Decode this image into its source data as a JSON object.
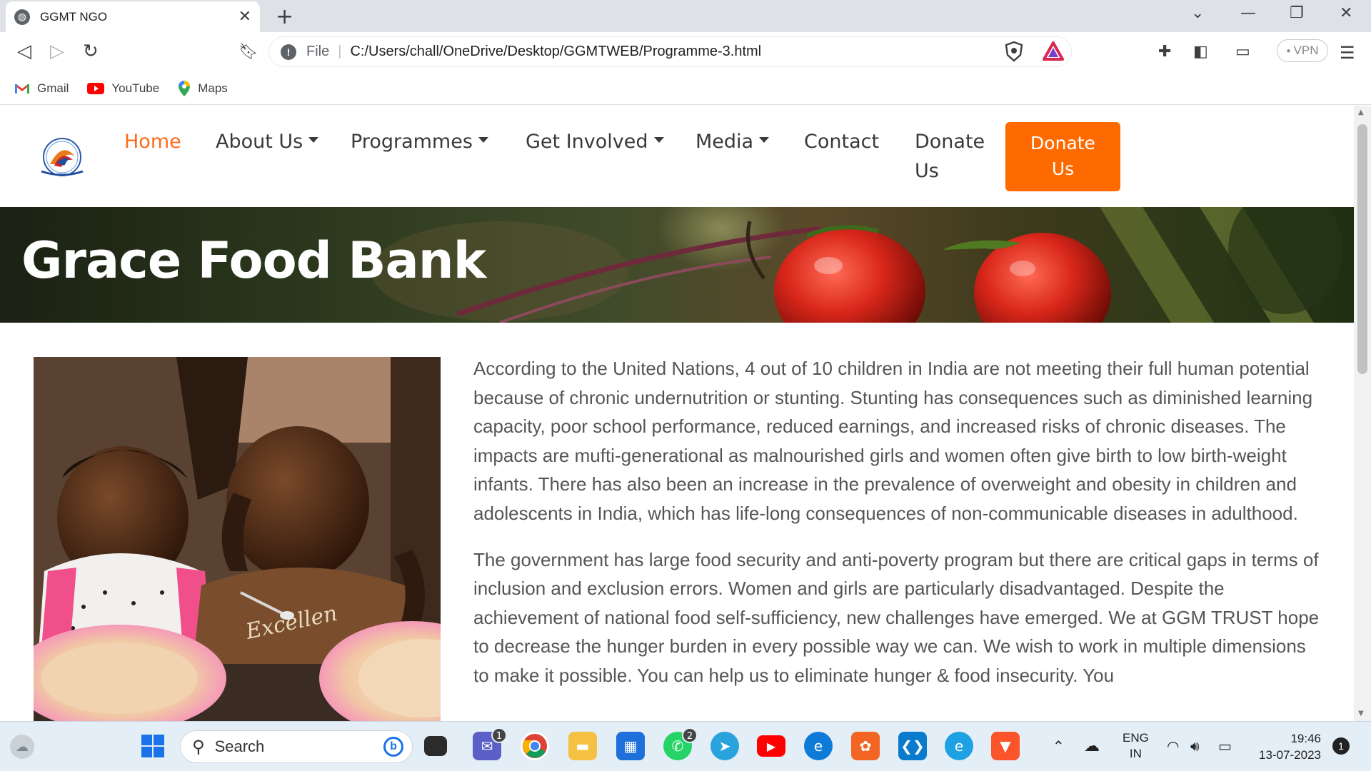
{
  "browser": {
    "tab_title": "GGMT NGO",
    "url_scheme": "File",
    "url_path": "C:/Users/chall/OneDrive/Desktop/GGMTWEB/Programme-3.html",
    "vpn_label": "VPN",
    "bookmarks": [
      {
        "label": "Gmail",
        "icon": "gmail-icon"
      },
      {
        "label": "YouTube",
        "icon": "youtube-icon"
      },
      {
        "label": "Maps",
        "icon": "maps-icon"
      }
    ]
  },
  "site": {
    "nav": {
      "home": "Home",
      "about": "About Us",
      "programmes": "Programmes",
      "get_involved": "Get Involved",
      "media": "Media",
      "contact": "Contact",
      "donate_line1": "Donate",
      "donate_line2": "Us",
      "donate_button_line1": "Donate",
      "donate_button_line2": "Us"
    },
    "accent_color": "#ff6a00",
    "hero_title": "Grace Food Bank",
    "paragraphs": [
      "According to the United Nations, 4 out of 10 children in India are not meeting their full human potential because of chronic undernutrition or stunting. Stunting has consequences such as diminished learning capacity, poor school performance, reduced earnings, and increased risks of chronic diseases. The impacts are mufti-generational as malnourished girls and women often give birth to low birth-weight infants. There has also been an increase in the prevalence of overweight and obesity in children and adolescents in India, which has life-long consequences of non-communicable diseases in adulthood.",
      "The government has large food security and anti-poverty program but there are critical gaps in terms of inclusion and exclusion errors. Women and girls are particularly disadvantaged. Despite the achievement of national food self-sufficiency, new challenges have emerged. We at GGM TRUST hope to decrease the hunger burden in every possible way we can. We wish to work in multiple dimensions to make it possible. You can help us to eliminate hunger & food insecurity. You"
    ],
    "photo_shirt_text": "Excellen"
  },
  "taskbar": {
    "search_label": "Search",
    "chat_badge": "1",
    "whatsapp_badge": "2",
    "lang_line1": "ENG",
    "lang_line2": "IN",
    "time": "19:46",
    "date": "13-07-2023",
    "notification_count": "1"
  }
}
